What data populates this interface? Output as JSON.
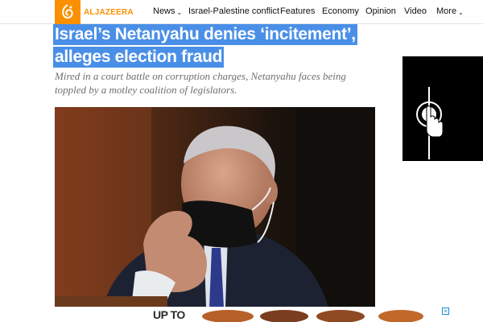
{
  "brand": {
    "logo_text": "ALJAZEERA",
    "color": "#fa9000"
  },
  "nav": {
    "items": [
      {
        "label": "News",
        "has_dropdown": true
      },
      {
        "label": "Israel-Palestine conflict",
        "has_dropdown": false
      },
      {
        "label": "Features",
        "has_dropdown": false
      },
      {
        "label": "Economy",
        "has_dropdown": false
      },
      {
        "label": "Opinion",
        "has_dropdown": false
      },
      {
        "label": "Video",
        "has_dropdown": false
      },
      {
        "label": "More",
        "has_dropdown": true
      }
    ]
  },
  "article": {
    "headline_line1": "Israel’s Netanyahu denies ‘incitement’,",
    "headline_line2": "alleges election fraud",
    "standfirst": "Mired in a court battle on corruption charges, Netanyahu faces being toppled by a motley coalition of legislators.",
    "selection_color": "#4a8fe7"
  },
  "ads": {
    "side_icon": "tap-hand-icon",
    "bottom_text": "UP TO",
    "bottom_icon": "close-icon"
  }
}
